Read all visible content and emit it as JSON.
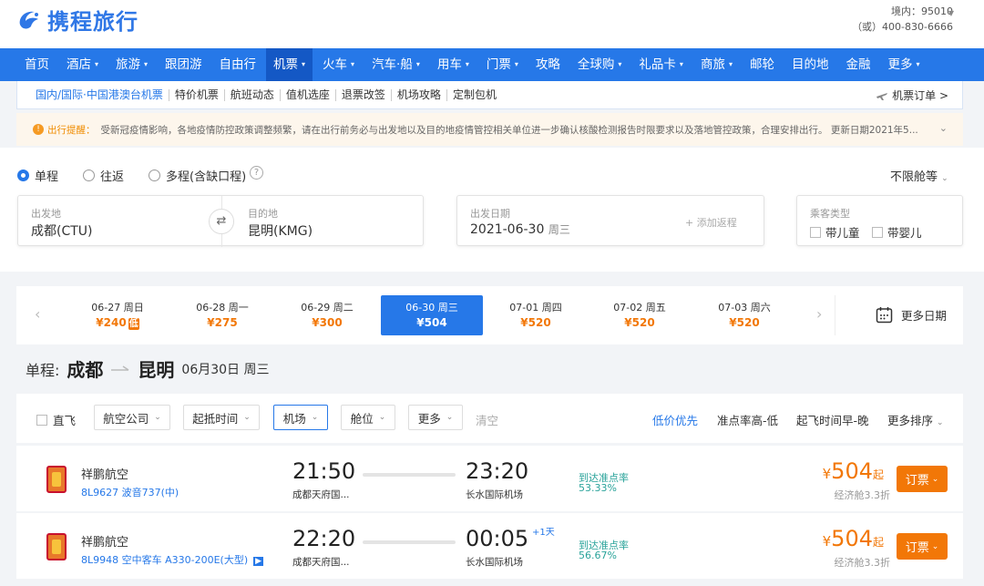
{
  "header": {
    "brand": "携程旅行",
    "hotline_domestic": "境内：95010",
    "hotline_alt": "（或）400-830-6666"
  },
  "nav": [
    {
      "label": "首页",
      "dropdown": false
    },
    {
      "label": "酒店",
      "dropdown": true
    },
    {
      "label": "旅游",
      "dropdown": true
    },
    {
      "label": "跟团游",
      "dropdown": false
    },
    {
      "label": "自由行",
      "dropdown": false
    },
    {
      "label": "机票",
      "dropdown": true,
      "active": true
    },
    {
      "label": "火车",
      "dropdown": true
    },
    {
      "label": "汽车·船",
      "dropdown": true
    },
    {
      "label": "用车",
      "dropdown": true
    },
    {
      "label": "门票",
      "dropdown": true
    },
    {
      "label": "攻略",
      "dropdown": false
    },
    {
      "label": "全球购",
      "dropdown": true
    },
    {
      "label": "礼品卡",
      "dropdown": true
    },
    {
      "label": "商旅",
      "dropdown": true
    },
    {
      "label": "邮轮",
      "dropdown": false
    },
    {
      "label": "目的地",
      "dropdown": false
    },
    {
      "label": "金融",
      "dropdown": false
    },
    {
      "label": "更多",
      "dropdown": true
    }
  ],
  "subnav": [
    "国内/国际·中国港澳台机票",
    "特价机票",
    "航班动态",
    "值机选座",
    "退票改签",
    "机场攻略",
    "定制包机"
  ],
  "subnav_orders": "机票订单 >",
  "notice": {
    "label": "出行提醒：",
    "text": "受新冠疫情影响，各地疫情防控政策调整频繁，请在出行前务必与出发地以及目的地疫情管控相关单位进一步确认核酸检测报告时限要求以及落地管控政策，合理安排出行。 更新日期2021年5..."
  },
  "trip_type": {
    "one_way": "单程",
    "round_trip": "往返",
    "multi": "多程(含缺口程)",
    "cabin_class": "不限舱等"
  },
  "search": {
    "from_label": "出发地",
    "from_value": "成都(CTU)",
    "to_label": "目的地",
    "to_value": "昆明(KMG)",
    "date_label": "出发日期",
    "date_value": "2021-06-30",
    "date_weekday": "周三",
    "add_return": "+ 添加返程",
    "passenger_label": "乘客类型",
    "child": "带儿童",
    "infant": "带婴儿"
  },
  "dates": [
    {
      "date": "06-27",
      "weekday": "周日",
      "price": "¥240",
      "low": "低"
    },
    {
      "date": "06-28",
      "weekday": "周一",
      "price": "¥275"
    },
    {
      "date": "06-29",
      "weekday": "周二",
      "price": "¥300"
    },
    {
      "date": "06-30",
      "weekday": "周三",
      "price": "¥504",
      "selected": true
    },
    {
      "date": "07-01",
      "weekday": "周四",
      "price": "¥520"
    },
    {
      "date": "07-02",
      "weekday": "周五",
      "price": "¥520"
    },
    {
      "date": "07-03",
      "weekday": "周六",
      "price": "¥520"
    }
  ],
  "more_dates": "更多日期",
  "route": {
    "prefix": "单程:",
    "from": "成都",
    "to": "昆明",
    "date": "06月30日 周三"
  },
  "filters": {
    "direct": "直飞",
    "airline": "航空公司",
    "time": "起抵时间",
    "airport": "机场",
    "cabin": "舱位",
    "more": "更多",
    "clear": "清空"
  },
  "sorts": {
    "price": "低价优先",
    "ontime": "准点率高-低",
    "depart": "起飞时间早-晚",
    "more": "更多排序"
  },
  "flights": [
    {
      "airline": "祥鹏航空",
      "plane": "8L9627 波音737(中)",
      "dep_time": "21:50",
      "dep_airport": "成都天府国...",
      "arr_time": "23:20",
      "arr_airport": "长水国际机场",
      "next_day": "",
      "ontime_label": "到达准点率",
      "ontime_value": "53.33%",
      "currency": "¥",
      "price": "504",
      "price_suffix": "起",
      "cabin": "经济舱3.3折",
      "book": "订票"
    },
    {
      "airline": "祥鹏航空",
      "plane": "8L9948 空中客车 A330-200E(大型)",
      "dep_time": "22:20",
      "dep_airport": "成都天府国...",
      "arr_time": "00:05",
      "arr_airport": "长水国际机场",
      "next_day": "+1天",
      "ontime_label": "到达准点率",
      "ontime_value": "56.67%",
      "currency": "¥",
      "price": "504",
      "price_suffix": "起",
      "cabin": "经济舱3.3折",
      "book": "订票"
    }
  ],
  "colors": {
    "primary": "#2678e8",
    "accent": "#f27707",
    "nav_active": "#1458c5",
    "ontime": "#2aa39a"
  }
}
